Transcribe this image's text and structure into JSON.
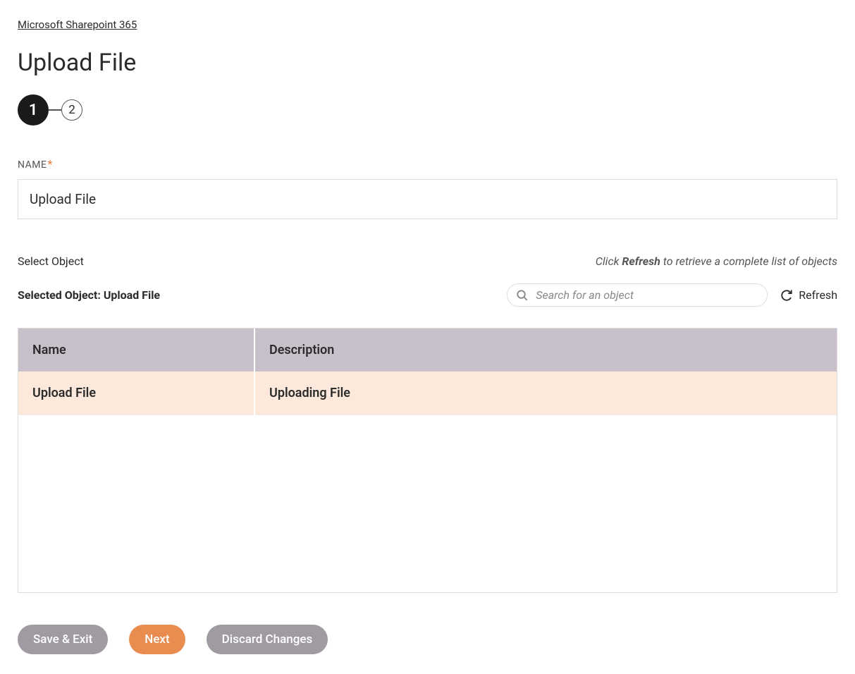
{
  "breadcrumb": "Microsoft Sharepoint 365",
  "page_title": "Upload File",
  "stepper": {
    "current": "1",
    "next": "2"
  },
  "form": {
    "name_label": "NAME",
    "name_value": "Upload File"
  },
  "select_object": {
    "label": "Select Object",
    "hint_prefix": "Click ",
    "hint_bold": "Refresh",
    "hint_suffix": " to retrieve a complete list of objects",
    "selected_prefix": "Selected Object: ",
    "selected_value": "Upload File",
    "search_placeholder": "Search for an object",
    "refresh_label": "Refresh"
  },
  "table": {
    "headers": {
      "name": "Name",
      "description": "Description"
    },
    "rows": [
      {
        "name": "Upload File",
        "description": "Uploading File"
      }
    ]
  },
  "buttons": {
    "save_exit": "Save & Exit",
    "next": "Next",
    "discard": "Discard Changes"
  }
}
